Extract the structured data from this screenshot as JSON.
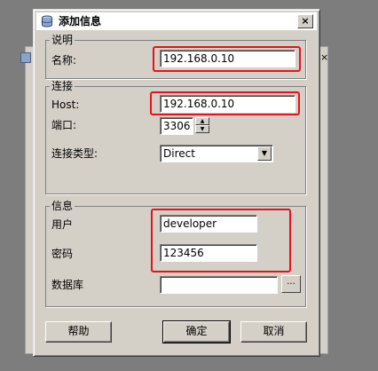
{
  "dialog": {
    "title": "添加信息",
    "close_glyph": "×"
  },
  "description_group": {
    "legend": "说明",
    "name_label": "名称:",
    "name_value": "192.168.0.10"
  },
  "connection_group": {
    "legend": "连接",
    "host_label": "Host:",
    "host_value": "192.168.0.10",
    "port_label": "端口:",
    "port_value": "3306",
    "type_label": "连接类型:",
    "type_value": "Direct"
  },
  "info_group": {
    "legend": "信息",
    "user_label": "用户",
    "user_value": "developer",
    "password_label": "密码",
    "password_value": "123456",
    "database_label": "数据库",
    "database_value": "",
    "browse_label": "..."
  },
  "buttons": {
    "help": "帮助",
    "ok": "确定",
    "cancel": "取消"
  },
  "colors": {
    "highlight": "#e8121a",
    "dialog_bg": "#d4d0c8"
  }
}
